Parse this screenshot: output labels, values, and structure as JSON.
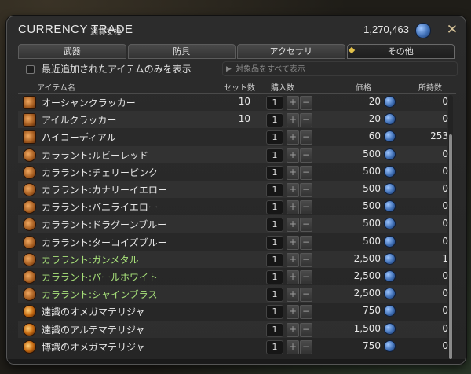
{
  "window": {
    "title": "CURRENCY TRADE",
    "subtitle": "通貨交換",
    "gil": "1,270,463",
    "close_icon": "close-x-icon"
  },
  "tabs": [
    {
      "label": "武器",
      "active": false
    },
    {
      "label": "防具",
      "active": false
    },
    {
      "label": "アクセサリ",
      "active": false
    },
    {
      "label": "その他",
      "active": true
    }
  ],
  "filters": {
    "recent_only_label": "最近追加されたアイテムのみを表示",
    "show_all_label": "対象品をすべて表示"
  },
  "columns": {
    "name": "アイテム名",
    "set_count": "セット数",
    "buy_count": "購入数",
    "price": "価格",
    "owned": "所持数"
  },
  "items": [
    {
      "name": "オーシャンクラッカー",
      "set": "10",
      "qty": "1",
      "price": "20",
      "owned": "0",
      "icon": "food-icon",
      "highlight": false
    },
    {
      "name": "アイルクラッカー",
      "set": "10",
      "qty": "1",
      "price": "20",
      "owned": "0",
      "icon": "food-icon",
      "highlight": false
    },
    {
      "name": "ハイコーディアル",
      "set": "",
      "qty": "1",
      "price": "60",
      "owned": "253",
      "icon": "potion-icon",
      "highlight": false
    },
    {
      "name": "カララント:ルビーレッド",
      "set": "",
      "qty": "1",
      "price": "500",
      "owned": "0",
      "icon": "dye-icon",
      "highlight": false
    },
    {
      "name": "カララント:チェリーピンク",
      "set": "",
      "qty": "1",
      "price": "500",
      "owned": "0",
      "icon": "dye-icon",
      "highlight": false
    },
    {
      "name": "カララント:カナリーイエロー",
      "set": "",
      "qty": "1",
      "price": "500",
      "owned": "0",
      "icon": "dye-icon",
      "highlight": false
    },
    {
      "name": "カララント:バニライエロー",
      "set": "",
      "qty": "1",
      "price": "500",
      "owned": "0",
      "icon": "dye-icon",
      "highlight": false
    },
    {
      "name": "カララント:ドラグーンブルー",
      "set": "",
      "qty": "1",
      "price": "500",
      "owned": "0",
      "icon": "dye-icon",
      "highlight": false
    },
    {
      "name": "カララント:ターコイズブルー",
      "set": "",
      "qty": "1",
      "price": "500",
      "owned": "0",
      "icon": "dye-icon",
      "highlight": false
    },
    {
      "name": "カララント:ガンメタル",
      "set": "",
      "qty": "1",
      "price": "2,500",
      "owned": "1",
      "icon": "dye-icon",
      "highlight": true
    },
    {
      "name": "カララント:パールホワイト",
      "set": "",
      "qty": "1",
      "price": "2,500",
      "owned": "0",
      "icon": "dye-icon",
      "highlight": true
    },
    {
      "name": "カララント:シャインブラス",
      "set": "",
      "qty": "1",
      "price": "2,500",
      "owned": "0",
      "icon": "dye-icon",
      "highlight": true
    },
    {
      "name": "達識のオメガマテリジャ",
      "set": "",
      "qty": "1",
      "price": "750",
      "owned": "0",
      "icon": "materia-icon",
      "highlight": false
    },
    {
      "name": "達識のアルテマテリジャ",
      "set": "",
      "qty": "1",
      "price": "1,500",
      "owned": "0",
      "icon": "materia-icon",
      "highlight": false
    },
    {
      "name": "博識のオメガマテリジャ",
      "set": "",
      "qty": "1",
      "price": "750",
      "owned": "0",
      "icon": "materia-icon",
      "highlight": false
    }
  ],
  "colors": {
    "highlight_text": "#a8e27a",
    "gil_coin": "#3f6fb5"
  }
}
